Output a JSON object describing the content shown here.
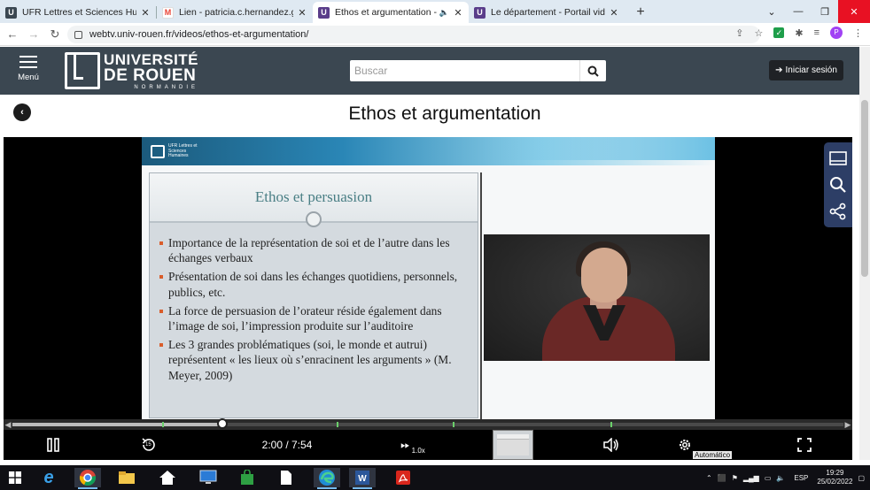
{
  "browser": {
    "tabs": [
      {
        "title": "UFR Lettres et Sciences Humaines",
        "favicon_color": "#3b4751",
        "active": false
      },
      {
        "title": "Lien - patricia.c.hernandez.gr@g",
        "favicon_color": "#ea4335",
        "active": false
      },
      {
        "title": "Ethos et argumentation - Po",
        "favicon_color": "#5a3d8a",
        "active": true
      },
      {
        "title": "Le département - Portail vidéo de",
        "favicon_color": "#5a3d8a",
        "active": false
      }
    ],
    "url": "webtv.univ-rouen.fr/videos/ethos-et-argumentation/",
    "profile_initial": "P"
  },
  "site": {
    "menu_label": "Menú",
    "logo": {
      "line1": "UNIVERSITÉ",
      "line2": "DE ROUEN",
      "line3": "NORMANDIE"
    },
    "search_placeholder": "Buscar",
    "login_label": "Iniciar sesión",
    "page_title": "Ethos et argumentation"
  },
  "slide": {
    "heading": "Ethos et persuasion",
    "bullets": [
      "Importance de la représentation de soi et de l’autre dans les échanges verbaux",
      "Présentation de soi dans les échanges quotidiens, personnels, publics, etc.",
      "La force de persuasion de l’orateur réside également dans l’image de soi, l’impression produite sur l’auditoire",
      "Les 3 grandes problématiques (soi, le monde et autrui) représentent « les lieux où s’enracinent les arguments » (M. Meyer, 2009)"
    ],
    "logo_text": "UFR Lettres et Sciences Humaines"
  },
  "player": {
    "time_display": "2:00 / 7:54",
    "progress_fraction": 0.253,
    "rewind_label": "15",
    "speed_label": "1.0x",
    "quality_label": "Automático",
    "chapter_fractions": [
      0.18,
      0.39,
      0.53,
      0.72
    ]
  },
  "taskbar": {
    "language": "ESP",
    "time": "19:29",
    "date": "25/02/2022"
  },
  "colors": {
    "header_bg": "#3b4751",
    "accent_blue": "#2d3e66",
    "chapter_green": "#6bd06b"
  }
}
